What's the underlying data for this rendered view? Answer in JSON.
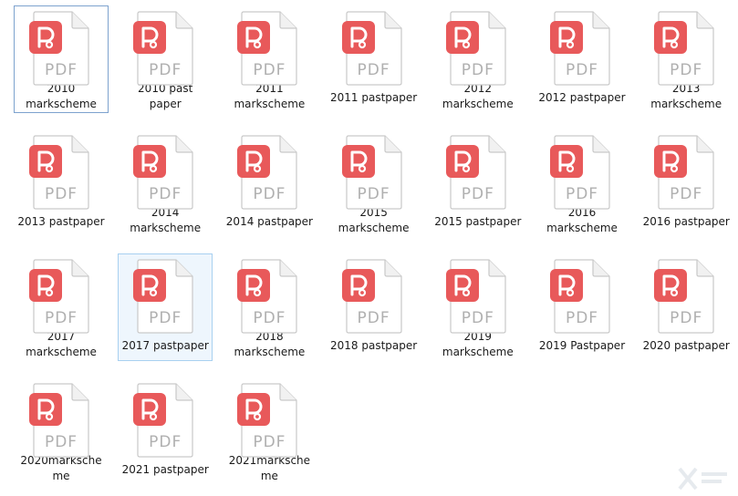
{
  "icon": {
    "name": "pdf-file-icon",
    "type_label": "PDF",
    "badge_color": "#e8595a",
    "page_fill": "#ffffff",
    "page_stroke": "#c9c9c9",
    "type_text_color": "#b0b0b0"
  },
  "files": [
    {
      "label": "2010\nmarkscheme",
      "state": "selected"
    },
    {
      "label": "2010 past\npaper",
      "state": ""
    },
    {
      "label": "2011\nmarkscheme",
      "state": ""
    },
    {
      "label": "2011 pastpaper",
      "state": ""
    },
    {
      "label": "2012\nmarkscheme",
      "state": ""
    },
    {
      "label": "2012 pastpaper",
      "state": ""
    },
    {
      "label": "2013\nmarkscheme",
      "state": ""
    },
    {
      "label": "2013 pastpaper",
      "state": ""
    },
    {
      "label": "2014\nmarkscheme",
      "state": ""
    },
    {
      "label": "2014 pastpaper",
      "state": ""
    },
    {
      "label": "2015\nmarkscheme",
      "state": ""
    },
    {
      "label": "2015 pastpaper",
      "state": ""
    },
    {
      "label": "2016\nmarkscheme",
      "state": ""
    },
    {
      "label": "2016 pastpaper",
      "state": ""
    },
    {
      "label": "2017\nmarkscheme",
      "state": ""
    },
    {
      "label": "2017 pastpaper",
      "state": "hover"
    },
    {
      "label": "2018\nmarkscheme",
      "state": ""
    },
    {
      "label": "2018 pastpaper",
      "state": ""
    },
    {
      "label": "2019\nmarkscheme",
      "state": ""
    },
    {
      "label": "2019 Pastpaper",
      "state": ""
    },
    {
      "label": "2020 pastpaper",
      "state": ""
    },
    {
      "label": "2020marksche\nme",
      "state": ""
    },
    {
      "label": "2021 pastpaper",
      "state": ""
    },
    {
      "label": "2021marksche\nme",
      "state": ""
    }
  ]
}
